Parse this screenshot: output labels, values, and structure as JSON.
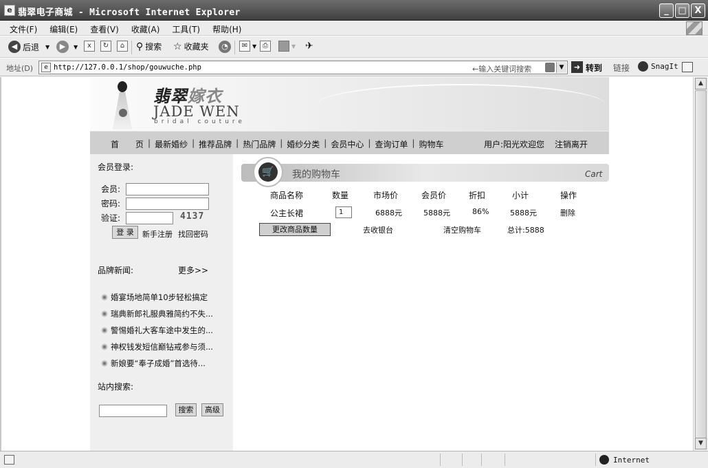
{
  "window": {
    "title": "翡翠电子商城 - Microsoft Internet Explorer",
    "buttons": [
      "_",
      "□",
      "X"
    ]
  },
  "menubar": [
    "文件(F)",
    "编辑(E)",
    "查看(V)",
    "收藏(A)",
    "工具(T)",
    "帮助(H)"
  ],
  "toolbar": {
    "back": "后退",
    "search": "搜索",
    "favorites": "收藏夹"
  },
  "address": {
    "label": "地址(D)",
    "url": "http://127.0.0.1/shop/gouwuche.php",
    "keyword_hint": "←输入关键词搜索",
    "go": "转到",
    "links": "链接",
    "snagit": "SnagIt"
  },
  "site": {
    "logo_cn_a": "翡翠",
    "logo_cn_b": "嫁衣",
    "logo_en": "JADE WEN",
    "logo_sub": "bridal couture",
    "nav": [
      "首　　页",
      "最新婚纱",
      "推荐品牌",
      "热门品牌",
      "婚纱分类",
      "会员中心",
      "查询订单",
      "购物车"
    ],
    "nav_sep": "|",
    "user_greeting": "用户:阳光欢迎您",
    "logout": "注销离开"
  },
  "login": {
    "title": "会员登录:",
    "member_label": "会员:",
    "password_label": "密码:",
    "verify_label": "验证:",
    "captcha": "4137",
    "login_button": "登 录",
    "register": "新手注册",
    "recover": "找回密码"
  },
  "news": {
    "title": "品牌新闻:",
    "more": "更多>>",
    "items": [
      "婚宴场地简单10步轻松搞定",
      "瑞典新郎礼服典雅简约不失...",
      "警惕婚礼大客车途中发生的...",
      "神权钱发短信巅钻戒参与须...",
      "新娘要“奉子成婚”首选待..."
    ]
  },
  "site_search": {
    "title": "站内搜索:",
    "search_button": "搜索",
    "advanced_button": "高级"
  },
  "cart": {
    "title": "我的购物车",
    "title_en": "Cart",
    "headers": [
      "商品名称",
      "数量",
      "市场价",
      "会员价",
      "折扣",
      "小计",
      "操作"
    ],
    "row": {
      "name": "公主长裙",
      "qty": "1",
      "market_price": "6888元",
      "member_price": "5888元",
      "discount": "86%",
      "subtotal": "5888元",
      "action": "删除"
    },
    "update_button": "更改商品数量",
    "checkout": "去收银台",
    "clear": "清空购物车",
    "total": "总计:5888"
  },
  "status": {
    "zone": "Internet"
  }
}
